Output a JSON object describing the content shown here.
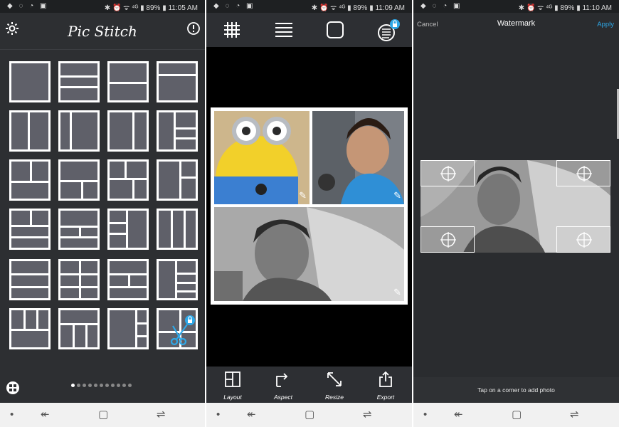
{
  "screen1": {
    "status": {
      "left_icons": "◆ ◌ ◔ ▣",
      "right": "✱ ⏰ ᯤ ⁴ᴳ ▮ 89% ▮ 11:05 AM"
    },
    "title": "Pic Stitch",
    "icons": {
      "settings": "gear-icon",
      "info": "info-icon",
      "layouts": "layouts-icon"
    },
    "page_dots": 11,
    "active_dot": 0
  },
  "screen2": {
    "status": {
      "left_icons": "◆ ◌ ◔ ▣",
      "right": "✱ ⏰ ᯤ ⁴ᴳ ▮ 89% ▮ 11:09 AM"
    },
    "toolbar_icons": [
      "grid-icon",
      "lines-icon",
      "rounded-square-icon",
      "hamburger-lock-icon"
    ],
    "bottom": [
      {
        "label": "Layout",
        "icon": "layout-icon"
      },
      {
        "label": "Aspect",
        "icon": "aspect-icon"
      },
      {
        "label": "Resize",
        "icon": "resize-icon"
      },
      {
        "label": "Export",
        "icon": "export-icon"
      }
    ]
  },
  "screen3": {
    "status": {
      "left_icons": "◆ ◌ ◔ ▣",
      "right": "✱ ⏰ ᯤ ⁴ᴳ ▮ 89% ▮ 11:10 AM"
    },
    "cancel": "Cancel",
    "title": "Watermark",
    "apply": "Apply",
    "hint": "Tap on a corner to add photo"
  },
  "nav": {
    "dot": "•",
    "back": "↞",
    "home": "▢",
    "recent": "⇌"
  },
  "colors": {
    "accent": "#2ea8e8",
    "tile": "#5f6069",
    "bar": "#2d2f33"
  }
}
